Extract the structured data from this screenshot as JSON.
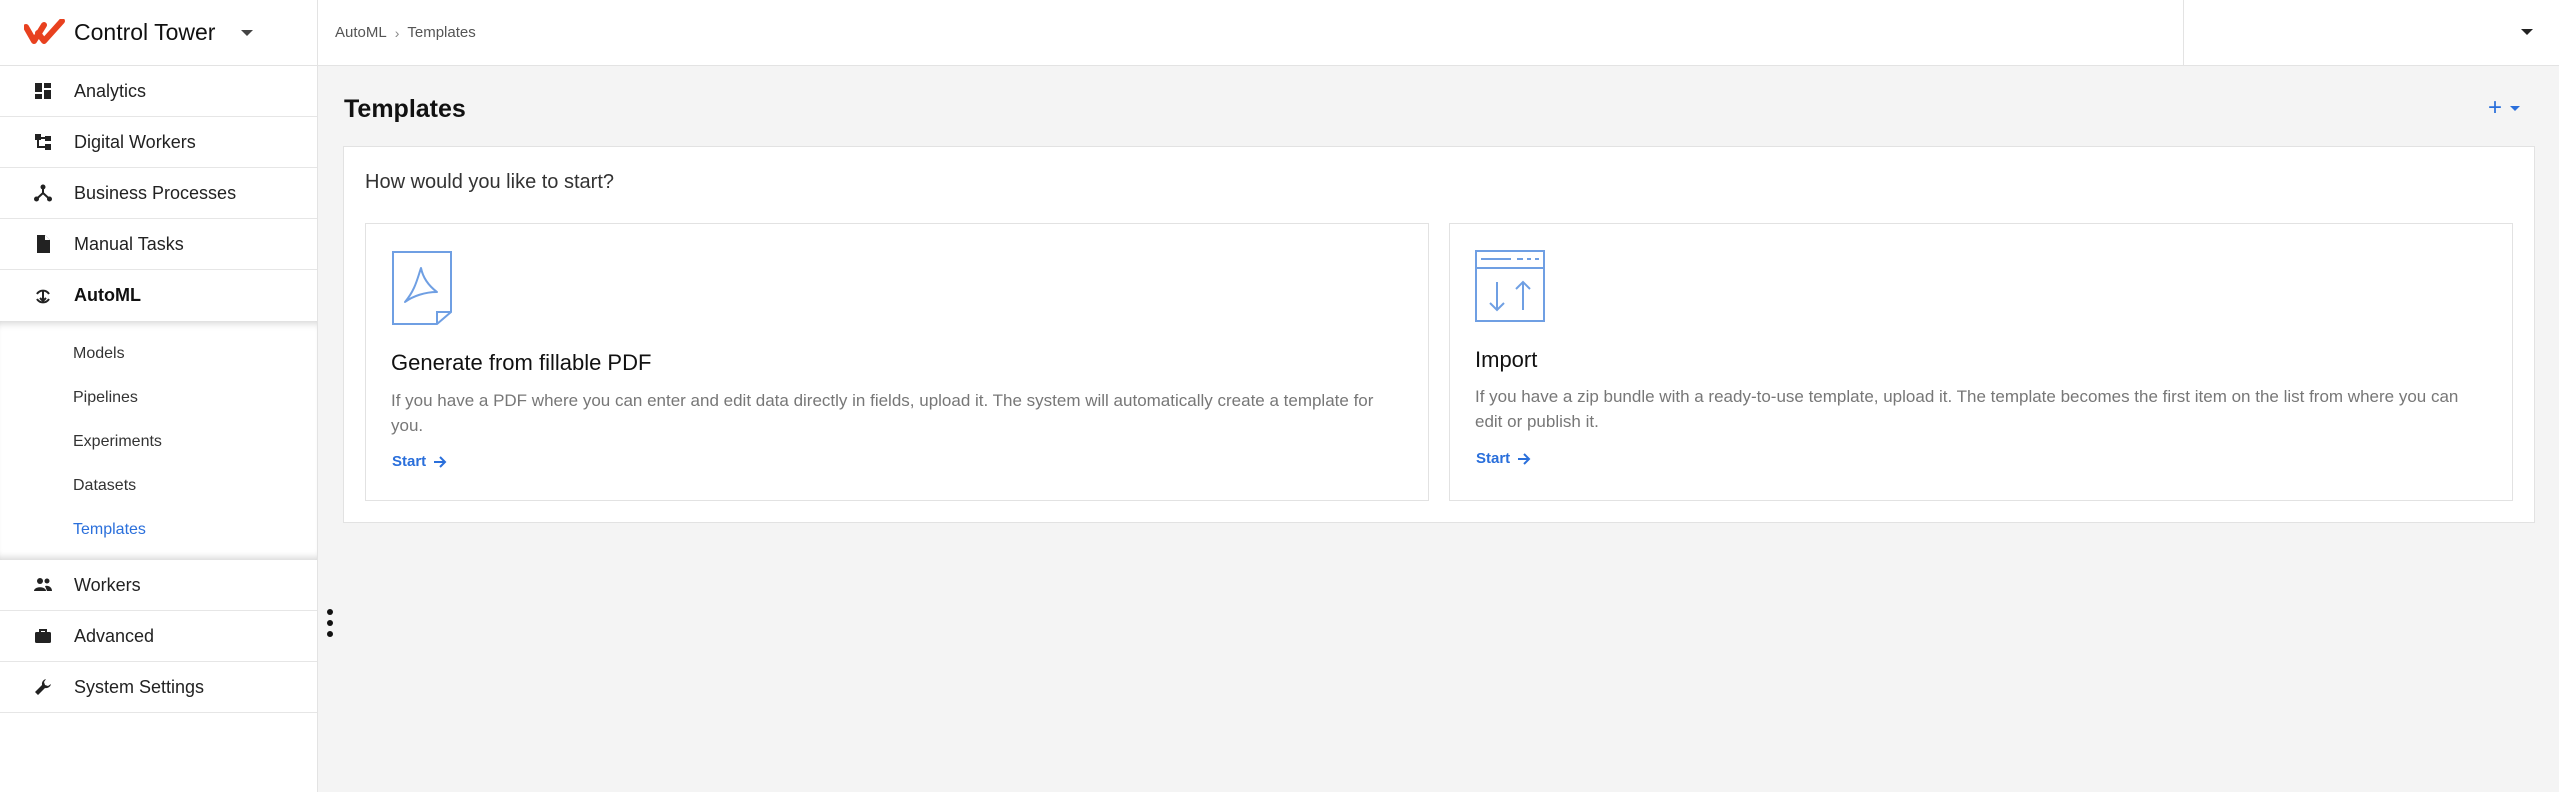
{
  "brand": {
    "title": "Control Tower",
    "accent": "#e8411f"
  },
  "sidebar": {
    "items": [
      {
        "label": "Analytics",
        "icon": "dashboard-icon"
      },
      {
        "label": "Digital Workers",
        "icon": "hierarchy-icon"
      },
      {
        "label": "Business Processes",
        "icon": "process-icon"
      },
      {
        "label": "Manual Tasks",
        "icon": "document-icon"
      },
      {
        "label": "AutoML",
        "icon": "automl-icon"
      }
    ],
    "automl_sub": [
      {
        "label": "Models"
      },
      {
        "label": "Pipelines"
      },
      {
        "label": "Experiments"
      },
      {
        "label": "Datasets"
      },
      {
        "label": "Templates"
      }
    ],
    "bottom_items": [
      {
        "label": "Workers",
        "icon": "people-icon"
      },
      {
        "label": "Advanced",
        "icon": "briefcase-icon"
      },
      {
        "label": "System Settings",
        "icon": "wrench-icon"
      }
    ]
  },
  "breadcrumb": {
    "parent": "AutoML",
    "current": "Templates"
  },
  "page": {
    "title": "Templates",
    "add_label": "+",
    "question": "How would you like to start?"
  },
  "cards": [
    {
      "title": "Generate from fillable PDF",
      "description": "If you have a PDF where you can enter and edit data directly in fields, upload it. The system will automatically create a template for you.",
      "link": "Start",
      "icon": "pdf-file-icon"
    },
    {
      "title": "Import",
      "description": "If you have a zip bundle with a ready-to-use template, upload it. The template becomes the first item on the list from where you can edit or publish it.",
      "link": "Start",
      "icon": "import-icon"
    }
  ],
  "colors": {
    "link": "#2a6fdb",
    "icon_outline": "#6f9fe3"
  }
}
